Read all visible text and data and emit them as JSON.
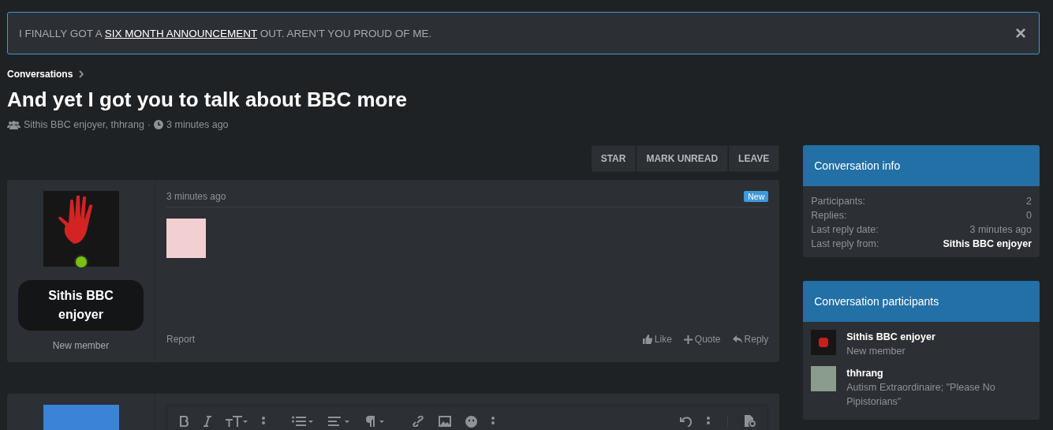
{
  "notice": {
    "before": "I FINALLY GOT A ",
    "link": "SIX MONTH ANNOUNCEMENT",
    "after": " OUT. AREN'T YOU PROUD OF ME.",
    "close": "×"
  },
  "breadcrumb": {
    "label": "Conversations"
  },
  "title": "And yet I got you to talk about BBC more",
  "meta": {
    "participants": "Sithis BBC enjoyer, thhrang",
    "separator": "·",
    "time": "3 minutes ago"
  },
  "actions": [
    "STAR",
    "MARK UNREAD",
    "LEAVE"
  ],
  "message": {
    "author": "Sithis BBC enjoyer",
    "role": "New member",
    "online": true,
    "time": "3 minutes ago",
    "badge": "New",
    "report": "Report",
    "buttons": [
      {
        "kind": "like",
        "label": "Like"
      },
      {
        "kind": "quote",
        "label": "Quote"
      },
      {
        "kind": "reply",
        "label": "Reply"
      }
    ]
  },
  "editor": {
    "toolbar": [
      {
        "kind": "bold"
      },
      {
        "kind": "italic"
      },
      {
        "kind": "text-size"
      },
      {
        "kind": "more"
      },
      {
        "kind": "list"
      },
      {
        "kind": "align"
      },
      {
        "kind": "paragraph"
      },
      {
        "kind": "link"
      },
      {
        "kind": "image"
      },
      {
        "kind": "emoji"
      },
      {
        "kind": "more"
      },
      {
        "kind": "undo"
      },
      {
        "kind": "more"
      },
      {
        "kind": "preview"
      }
    ]
  },
  "info": {
    "title": "Conversation info",
    "rows": [
      {
        "label": "Participants:",
        "value": "2",
        "strong": false
      },
      {
        "label": "Replies:",
        "value": "0",
        "strong": false
      },
      {
        "label": "Last reply date:",
        "value": "3 minutes ago",
        "strong": false
      },
      {
        "label": "Last reply from:",
        "value": "Sithis BBC enjoyer",
        "strong": true
      }
    ]
  },
  "participants": {
    "title": "Conversation participants",
    "items": [
      {
        "name": "Sithis BBC enjoyer",
        "role": "New member",
        "kind": "hand"
      },
      {
        "name": "thhrang",
        "role": "Autism Extraordinaire; \"Please No Pipistorians\"",
        "kind": "cartoon"
      }
    ]
  }
}
